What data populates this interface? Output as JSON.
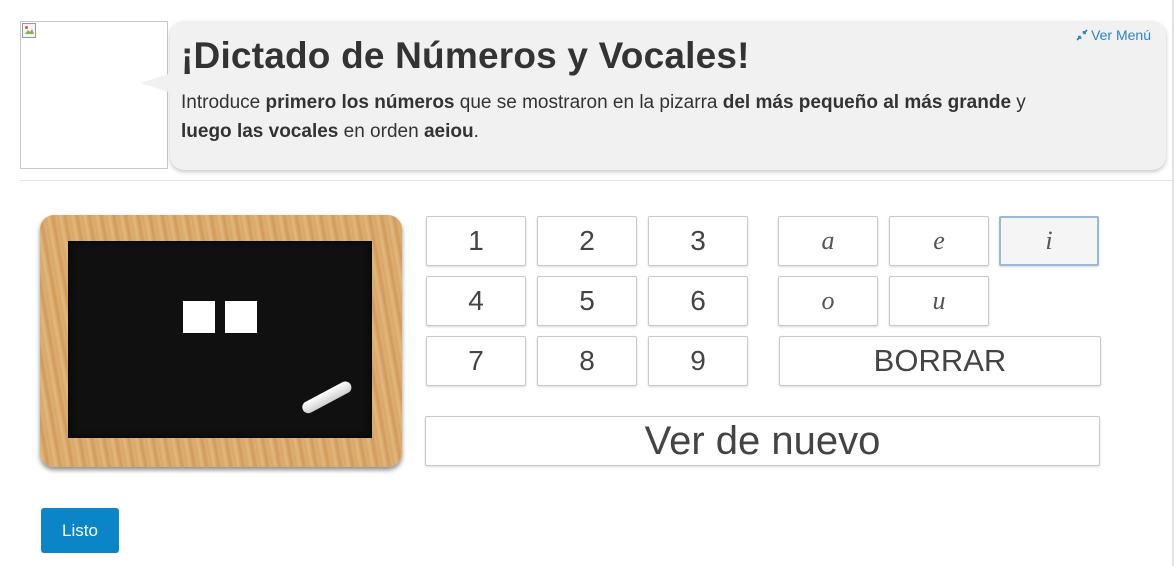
{
  "header": {
    "title": "¡Dictado de Números y Vocales!",
    "menu_link": "Ver Menú",
    "menu_icon": "compress-arrows-icon",
    "instructions": {
      "part1": "Introduce ",
      "part2": "primero los números",
      "part3": " que se mostraron en la pizarra ",
      "part4": "del más pequeño al más grande",
      "part5": " y ",
      "part6": "luego las vocales",
      "part7": " en orden ",
      "part8": "aeiou",
      "part9": "."
    },
    "avatar_icon": "broken-image-icon"
  },
  "board": {
    "squares_shown": 2
  },
  "keypad": {
    "numbers": [
      "1",
      "2",
      "3",
      "4",
      "5",
      "6",
      "7",
      "8",
      "9"
    ],
    "vowels": [
      "a",
      "e",
      "i",
      "o",
      "u"
    ],
    "active_vowel": "i",
    "clear_label": "BORRAR",
    "replay_label": "Ver de nuevo"
  },
  "actions": {
    "done_label": "Listo"
  },
  "colors": {
    "accent": "#0a86c8",
    "link": "#2a84c6",
    "bubble_bg": "#f1f1f1",
    "text": "#333333"
  }
}
